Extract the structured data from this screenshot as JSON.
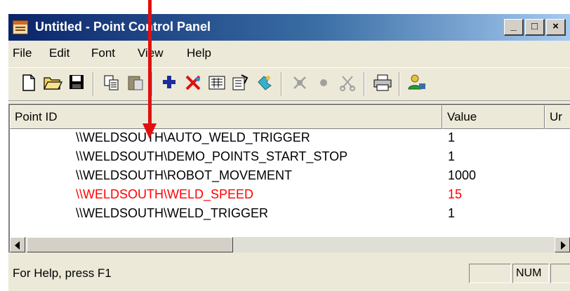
{
  "window": {
    "title": "Untitled - Point Control Panel",
    "buttons": {
      "minimize": "_",
      "maximize": "□",
      "close": "×"
    }
  },
  "menu": [
    {
      "label": "File"
    },
    {
      "label": "Edit"
    },
    {
      "label": "Font"
    },
    {
      "label": "View"
    },
    {
      "label": "Help"
    }
  ],
  "toolbar": {
    "icons": [
      "new-document-icon",
      "open-folder-icon",
      "save-icon",
      "copy-icon",
      "paste-icon",
      "add-point-icon",
      "delete-point-icon",
      "point-properties-icon",
      "settings-icon",
      "refresh-icon",
      "disabled-tool-icon",
      "disabled-dot-icon",
      "cut-icon",
      "print-icon",
      "user-icon"
    ]
  },
  "list": {
    "columns": {
      "id": "Point ID",
      "value": "Value",
      "units": "Ur"
    },
    "rows": [
      {
        "id": "\\\\WELDSOUTH\\AUTO_WELD_TRIGGER",
        "value": "1",
        "highlight": false
      },
      {
        "id": "\\\\WELDSOUTH\\DEMO_POINTS_START_STOP",
        "value": "1",
        "highlight": false
      },
      {
        "id": "\\\\WELDSOUTH\\ROBOT_MOVEMENT",
        "value": "1000",
        "highlight": false
      },
      {
        "id": "\\\\WELDSOUTH\\WELD_SPEED",
        "value": "15",
        "highlight": true
      },
      {
        "id": "\\\\WELDSOUTH\\WELD_TRIGGER",
        "value": "1",
        "highlight": false
      }
    ]
  },
  "statusbar": {
    "help": "For Help, press F1",
    "num": "NUM"
  },
  "colors": {
    "highlight_text": "#ff0000",
    "annotation_arrow": "#e01010",
    "title_gradient_start": "#0a246a"
  }
}
